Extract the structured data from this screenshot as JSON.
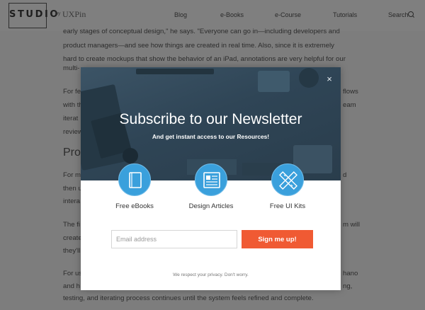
{
  "header": {
    "logo_text": "STUDIO",
    "logo_by": "by",
    "logo_brand": "UXPin",
    "nav": [
      "Blog",
      "e-Books",
      "e-Course",
      "Tutorials",
      "Search"
    ]
  },
  "background": {
    "lines": [
      "early stages of conceptual design,\" he says. \"Everyone can go in—including developers and",
      "product managers—and see how things are created in real time. Also, since it is extremely",
      "hard to create mockups that show the behavior of an iPad, annotations are very helpful for our",
      "multi-"
    ],
    "frag_left": [
      "For fe",
      "with th",
      "iterat",
      "review"
    ],
    "frag_right": [
      "flows",
      "eam"
    ],
    "heading": "Pro",
    "frag_left2": [
      "For m",
      "then u",
      "intera"
    ],
    "frag_right2": [
      "d"
    ],
    "frag_left3": [
      "The fi",
      "create",
      "they'll"
    ],
    "frag_right3": [
      "m will"
    ],
    "frag_left4": [
      "For us",
      "and h"
    ],
    "frag_right4": [
      "hano",
      "ng,"
    ],
    "last_line": "testing, and iterating process continues until the system feels refined and complete."
  },
  "modal": {
    "close_label": "×",
    "title": "Subscribe to our Newsletter",
    "subtitle_pre": "And get instant access to our ",
    "subtitle_bold": "Resources!",
    "features": [
      {
        "icon": "ebook-icon",
        "label": "Free eBooks"
      },
      {
        "icon": "article-icon",
        "label": "Design Articles"
      },
      {
        "icon": "ui-kit-icon",
        "label": "Free UI Kits"
      }
    ],
    "email_placeholder": "Email address",
    "signup_label": "Sign me up!",
    "privacy_text": "We respect your privacy. Don't worry."
  },
  "colors": {
    "accent": "#f05a33",
    "icon_blue": "#3aa0dc",
    "hero_dark": "#2f4556"
  }
}
